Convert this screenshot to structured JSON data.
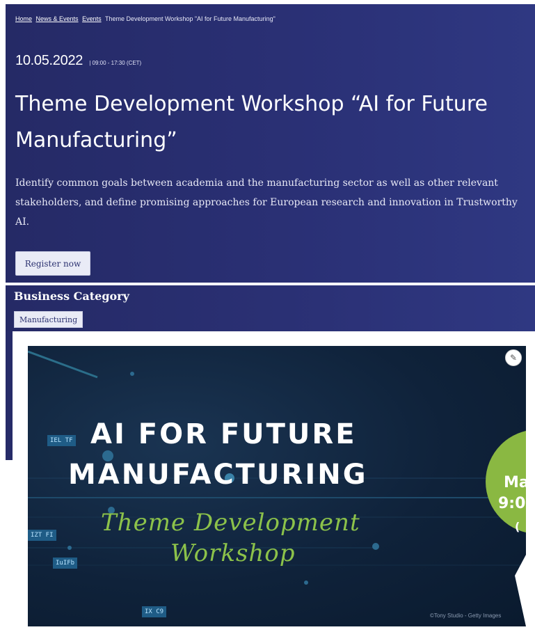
{
  "breadcrumb": {
    "home": "Home",
    "news_events": "News & Events",
    "events": "Events",
    "current": "Theme Development Workshop \"AI for Future Manufacturing\""
  },
  "event": {
    "date": "10.05.2022",
    "time": "| 09:00 - 17:30 (CET)",
    "title": "Theme Development Workshop “AI for Future Manufacturing”",
    "description": "Identify common goals between academia and the manufacturing sector as well as other relevant stakeholders, and define promising approaches for European research and innovation in Trustworthy AI.",
    "register_label": "Register now"
  },
  "category": {
    "heading": "Business Category",
    "tag": "Manufacturing"
  },
  "banner": {
    "line1": "AI FOR FUTURE",
    "line2": "MANUFACTURING",
    "sub1": "Theme Development",
    "sub2": "Workshop",
    "circle_text1": "Ma",
    "circle_text2": "9:0",
    "circle_text3": "(",
    "credit": "©Tony Studio - Getty Images",
    "chips": [
      "IEL TF",
      "IZT FI",
      "IuIFb",
      "IX C9"
    ],
    "edit_icon": "pencil-icon"
  },
  "colors": {
    "hero_bg": "#2a3075",
    "banner_bg": "#0f223a",
    "accent_green": "#8cc24a",
    "chip_blue": "#1f5c86"
  }
}
